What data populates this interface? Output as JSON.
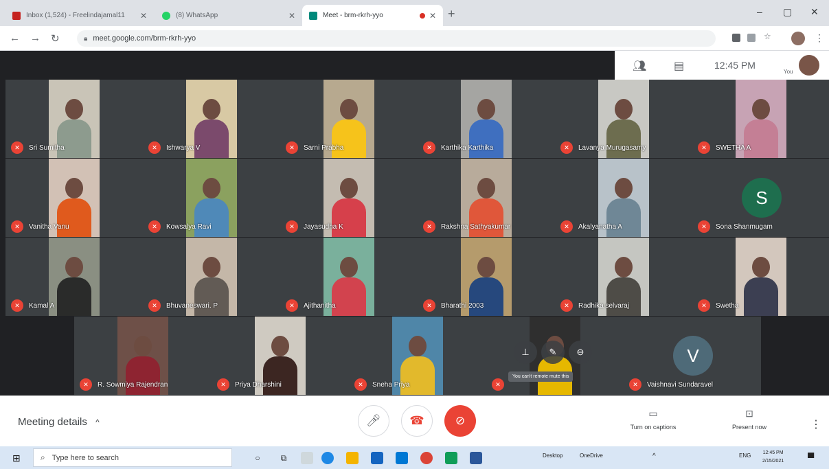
{
  "browser": {
    "tabs": [
      {
        "title": "Inbox (1,524) - Freelindajamal11",
        "fav_color": "#c5221f",
        "active": false
      },
      {
        "title": "(8) WhatsApp",
        "fav_color": "#25d366",
        "active": false
      },
      {
        "title": "Meet - brm-rkrh-yyo",
        "fav_color": "#00897b",
        "active": true,
        "recording": true
      }
    ],
    "url": "meet.google.com/brm-rkrh-yyo",
    "win_min": "–",
    "win_max": "▢",
    "win_close": "✕",
    "new_tab": "+"
  },
  "meet": {
    "clock": "12:45 PM",
    "you_label": "You",
    "participants": [
      {
        "name": "Sri Sumitha",
        "bg": "#c9c4b7",
        "shirt": "#8d9b8e"
      },
      {
        "name": "Ishwarya V",
        "bg": "#d8c9a4",
        "shirt": "#7b4a6c"
      },
      {
        "name": "Sarni Prabha",
        "bg": "#b7a98f",
        "shirt": "#f6c31b"
      },
      {
        "name": "Karthika Karthika",
        "bg": "#a5a5a2",
        "shirt": "#3f6fbf"
      },
      {
        "name": "Lavanya Murugasamy",
        "bg": "#c8c8c3",
        "shirt": "#6d6d4f"
      },
      {
        "name": "SWETHA A",
        "bg": "#c7a3b4",
        "shirt": "#c47f95"
      },
      {
        "name": "Vanitha Vanu",
        "bg": "#d2c1b5",
        "shirt": "#e05a1d"
      },
      {
        "name": "Kowsalya Ravi",
        "bg": "#8ba15f",
        "shirt": "#4f89b8"
      },
      {
        "name": "Jayasudha K",
        "bg": "#c4bcb1",
        "shirt": "#d6404b"
      },
      {
        "name": "Rakshna Sathyakumar",
        "bg": "#b8ab9b",
        "shirt": "#e0573a"
      },
      {
        "name": "Akalyanatha A",
        "bg": "#b8c2c9",
        "shirt": "#6f8796"
      },
      {
        "name": "Sona Shanmugam",
        "avatar_letter": "S",
        "avatar_color": "#1e6e4e"
      },
      {
        "name": "Kamal A",
        "bg": "#8a8f82",
        "shirt": "#2a2b2a"
      },
      {
        "name": "Bhuvaneswari. P",
        "bg": "#c4b7a8",
        "shirt": "#625b55"
      },
      {
        "name": "Ajithanitha",
        "bg": "#7ab09c",
        "shirt": "#d2434e"
      },
      {
        "name": "Bharathi 2003",
        "bg": "#b59b6c",
        "shirt": "#26487d"
      },
      {
        "name": "Radhika selvaraj",
        "bg": "#c5c6c1",
        "shirt": "#4e4c47"
      },
      {
        "name": "Swetha",
        "bg": "#d3c7bd",
        "shirt": "#3c3f52"
      },
      {
        "name": "R. Sowmiya Rajendran",
        "bg": "#6e5048",
        "shirt": "#8e2431"
      },
      {
        "name": "Priya Dharshini",
        "bg": "#cfcac1",
        "shirt": "#3c2622"
      },
      {
        "name": "Sneha Priya",
        "bg": "#4f86a8",
        "shirt": "#e2b92c"
      },
      {
        "name": "",
        "bg": "#2f2f2f",
        "shirt": "#e6b800",
        "hover": true
      },
      {
        "name": "Vaishnavi Sundaravel",
        "avatar_letter": "V",
        "avatar_color": "#4e6a78"
      }
    ],
    "hover_tooltip": "You can't remote mute this"
  },
  "bottom": {
    "meeting_details": "Meeting details",
    "meeting_details_chevron": "^",
    "captions_label": "Turn on captions",
    "present_label": "Present now",
    "more": "⋮"
  },
  "taskbar": {
    "search_placeholder": "Type here to search",
    "tray_desktop": "Desktop",
    "tray_onedrive": "OneDrive",
    "time": "12:45 PM",
    "date": "2/15/2021",
    "lang": "ENG"
  }
}
